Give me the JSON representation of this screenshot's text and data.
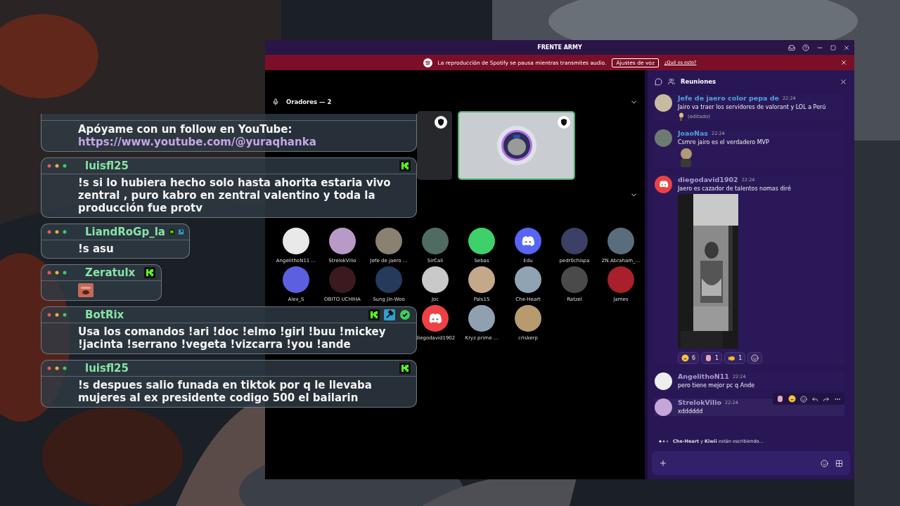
{
  "window": {
    "title": "FRENTE ARMY"
  },
  "banner": {
    "text": "La reproducción de Spotify se pausa mientras transmites audio.",
    "button": "Ajustes de voz",
    "link": "¿Qué es esto?"
  },
  "stage": {
    "speakers_header": "Oradores — 2",
    "speakers": [
      {
        "kind": "covered",
        "selected": false
      },
      {
        "kind": "cat",
        "selected": true
      }
    ],
    "audience": [
      {
        "name": "AngelithoN11 ...",
        "color": "#e9e9ea"
      },
      {
        "name": "StrelokVilio",
        "color": "#b89ac8"
      },
      {
        "name": "Jefe de jaero ...",
        "color": "#8a8270"
      },
      {
        "name": "SirCali",
        "color": "#4f6b62"
      },
      {
        "name": "Sebas",
        "color": "#3ed06a"
      },
      {
        "name": "Edu",
        "kind": "discord",
        "color": "#5865f2"
      },
      {
        "name": "pedr0chispa",
        "color": "#3c3f66"
      },
      {
        "name": "ZN Abraham_...",
        "color": "#5a6d7c"
      },
      {
        "name": "Alex_S",
        "color": "#5c5fe0"
      },
      {
        "name": "OBITO UCHIHA",
        "color": "#3a1a1e"
      },
      {
        "name": "Sung Jin-Woo",
        "color": "#263a5c"
      },
      {
        "name": "Joc",
        "color": "#c9c9c9"
      },
      {
        "name": "Pals15",
        "color": "#c4a88a"
      },
      {
        "name": "Che-Heart",
        "color": "#8fa3b5"
      },
      {
        "name": "Ratzel",
        "color": "#4a4a4a"
      },
      {
        "name": "James",
        "color": "#a8202c"
      },
      {
        "name": "diegodavid1902",
        "kind": "discord",
        "color": "#ed4245"
      },
      {
        "name": "Kryz prime ...",
        "color": "#8fa0b0"
      },
      {
        "name": "criskerp",
        "color": "#b89a70"
      }
    ]
  },
  "chat_panel": {
    "title": "Reuniones",
    "messages": [
      {
        "author": "Jefe de jaero color pepa de",
        "color": "#4fa3e0",
        "time": "22:24",
        "text": "Jairo va traer los servidores de valorant y LOL a Perú",
        "kind": "sticker",
        "edited": "(editado)",
        "hovered": false
      },
      {
        "author": "JoaoNas",
        "color": "#4fa3e0",
        "time": "22:24",
        "text": "Csmre jairo es el verdadero MVP",
        "kind": "big-sticker",
        "hovered": false
      },
      {
        "author": "diegodavid1902",
        "color": "#a99ccc",
        "avatar": {
          "kind": "discord",
          "color": "#ed4245"
        },
        "time": "22:24",
        "text": "Jaero es cazador de talentos nomas diré",
        "kind": "video",
        "hovered": false,
        "reactions": [
          {
            "kind": "laugh",
            "count": "6"
          },
          {
            "kind": "hand",
            "count": "1"
          },
          {
            "kind": "fish",
            "count": "1"
          },
          {
            "kind": "add"
          }
        ]
      },
      {
        "author": "AngelithoN11",
        "color": "#a99ccc",
        "time": "22:24",
        "text": "pero tiene mejor pc q Ande",
        "kind": "text",
        "hovered": false
      },
      {
        "author": "StrelokVilio",
        "color": "#a99ccc",
        "time": "22:24",
        "text": "xdddddd",
        "kind": "text",
        "hovered": true
      }
    ],
    "typing": "**Che-Heart** y **Kiwii** están escribiendo..."
  },
  "overlay": {
    "messages": [
      {
        "kind": "cut",
        "text": "Apóyame con un follow en YouTube:",
        "link": "https://www.youtube.com/@yuraqhanka"
      },
      {
        "user": "luisfl25",
        "text": "!s si lo hubiera hecho solo hasta ahorita estaria vivo zentral , puro kabro en zentral valentino y toda la producción fue protv",
        "badges": [
          {
            "kind": "kick"
          }
        ],
        "kind": "full"
      },
      {
        "user": "LiandRoGp_la",
        "text": "!s asu",
        "badges": [
          {
            "kind": "kick"
          },
          {
            "kind": "mod"
          }
        ],
        "kind": "inline"
      },
      {
        "user": "Zeratulx",
        "badges": [
          {
            "kind": "kick"
          }
        ],
        "kind": "emote"
      },
      {
        "user": "BotRix",
        "text": "Usa los comandos !ari !doc !elmo !girl !buu !mickey !jacinta !serrano !vegeta !vizcarra !you !ande",
        "badges": [
          {
            "kind": "kick"
          },
          {
            "kind": "mod"
          },
          {
            "kind": "verified"
          }
        ],
        "kind": "full"
      },
      {
        "user": "luisfl25",
        "text": "!s despues salio funada en tiktok por q le llevaba mujeres al ex presidente codigo 500 el bailarin",
        "badges": [
          {
            "kind": "kick"
          }
        ],
        "kind": "full"
      }
    ]
  }
}
